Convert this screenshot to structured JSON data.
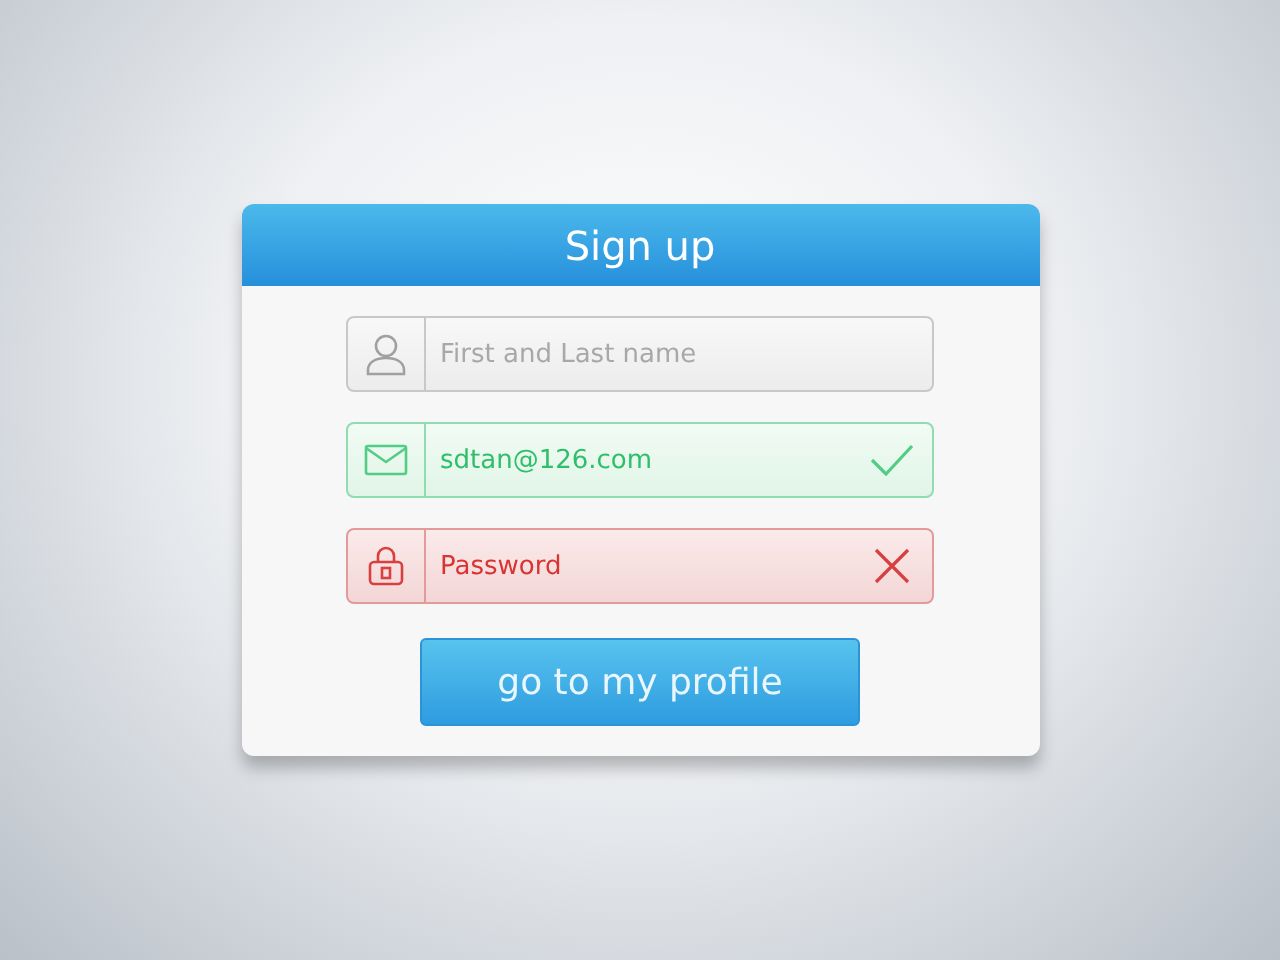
{
  "card": {
    "title": "Sign up"
  },
  "fields": [
    {
      "kind": "person",
      "valid": false,
      "invalid": false,
      "placeholder": "First and Last name"
    },
    {
      "kind": "email",
      "valid": true,
      "invalid": false,
      "value": "sdtan@126.com"
    },
    {
      "kind": "lock",
      "valid": false,
      "invalid": true,
      "placeholder": "Password"
    }
  ],
  "button": {
    "label": "go to my profile"
  }
}
